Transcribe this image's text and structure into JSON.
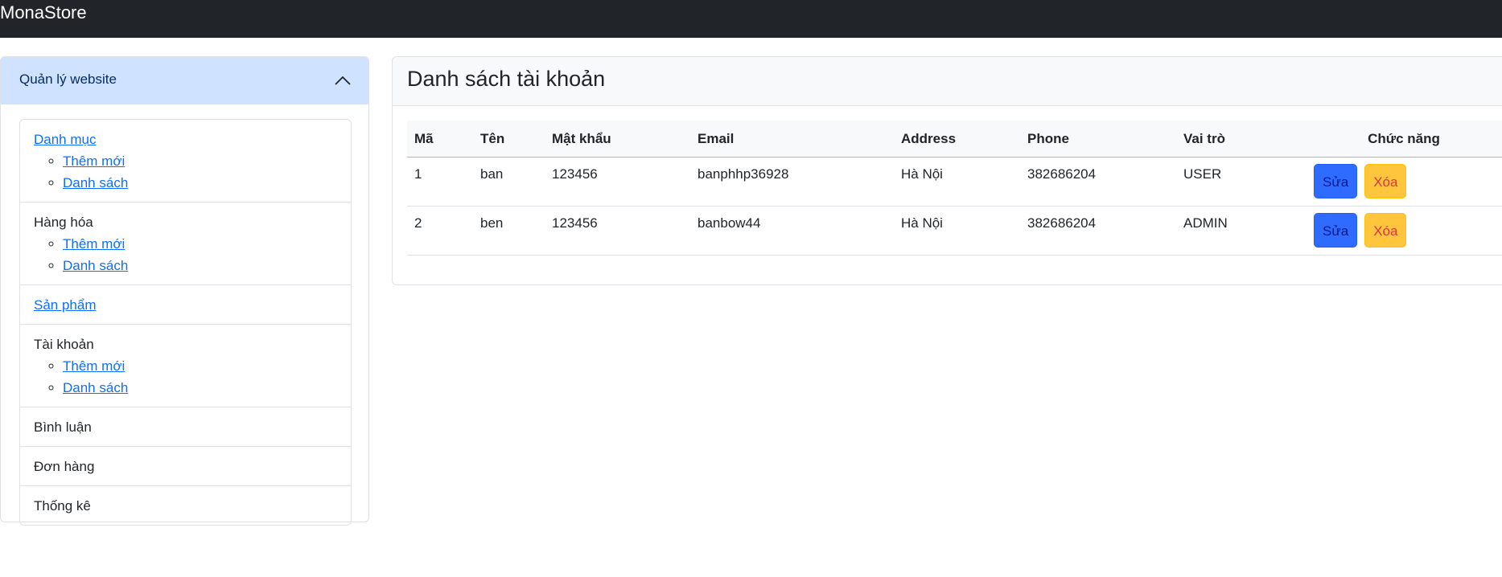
{
  "navbar": {
    "brand": "MonaStore"
  },
  "sidebar": {
    "title": "Quản lý website",
    "groups": [
      {
        "label": "Danh mục",
        "link": true,
        "children": [
          "Thêm mới",
          "Danh sách"
        ]
      },
      {
        "label": "Hàng hóa",
        "link": false,
        "children": [
          "Thêm mới",
          "Danh sách"
        ]
      },
      {
        "label": "Sản phẩm",
        "link": true,
        "children": []
      },
      {
        "label": "Tài khoản",
        "link": false,
        "children": [
          "Thêm mới",
          "Danh sách"
        ]
      },
      {
        "label": "Bình luận",
        "link": false,
        "children": []
      },
      {
        "label": "Đơn hàng",
        "link": false,
        "children": []
      },
      {
        "label": "Thống kê",
        "link": false,
        "children": []
      }
    ]
  },
  "main": {
    "title": "Danh sách tài khoản",
    "table": {
      "headers": [
        "Mã",
        "Tên",
        "Mật khẩu",
        "Email",
        "Address",
        "Phone",
        "Vai trò",
        "Chức năng"
      ],
      "rows": [
        {
          "id": "1",
          "name": "ban",
          "password": "123456",
          "email": "banphhp36928",
          "address": "Hà Nội",
          "phone": "382686204",
          "role": "USER"
        },
        {
          "id": "2",
          "name": "ben",
          "password": "123456",
          "email": "banbow44",
          "address": "Hà Nội",
          "phone": "382686204",
          "role": "ADMIN"
        }
      ],
      "edit_label": "Sửa",
      "delete_label": "Xóa"
    }
  }
}
